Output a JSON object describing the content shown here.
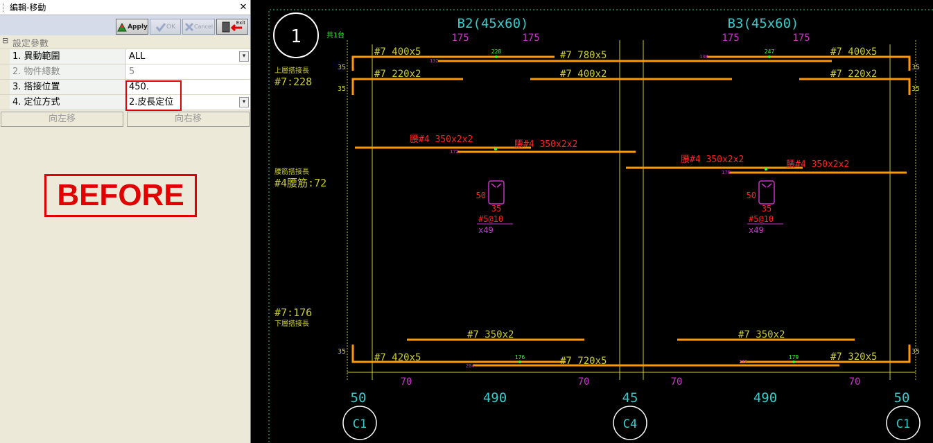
{
  "panel": {
    "title": "編輯-移動",
    "close_glyph": "✕",
    "toolbar": {
      "apply": "Apply",
      "ok": "OK",
      "cancel": "Cancel",
      "exit": "Exit"
    },
    "category": "設定參數",
    "category_toggle": "⊟",
    "rows": [
      {
        "label": "1. 異動範圍",
        "value": "ALL",
        "dropdown": true
      },
      {
        "label": "2. 物件總數",
        "value": "5",
        "disabled": true
      },
      {
        "label": "3. 搭接位置",
        "value": "450."
      },
      {
        "label": "4. 定位方式",
        "value": "2.皮長定位",
        "dropdown": true
      }
    ],
    "move_left": "向左移",
    "move_right": "向右移",
    "stamp": "BEFORE"
  },
  "drawing": {
    "colors": {
      "background": "#000000",
      "cyan": "#33cccc",
      "yellow": "#cccc33",
      "orange": "#ff9900",
      "magenta": "#cc33cc",
      "red": "#ff2222",
      "green": "#33ff33",
      "white": "#ffffff"
    },
    "circle_label": "1",
    "count_label": "共1台",
    "beam_b2": "B2(45x60)",
    "beam_b3": "B3(45x60)",
    "dim_175": "175",
    "top_lap_label": "上層搭接長",
    "top_lap_value": "#7:228",
    "waist_lap_label": "腰筋搭接長",
    "waist_lap_value": "#4腰筋:72",
    "bottom_lap_value": "#7:176",
    "bottom_lap_label": "下層搭接長",
    "top_bars": {
      "b2_t1": "#7 400x5",
      "b2_t1_right": "#7 780x5",
      "b3_t1": "#7 400x5",
      "b2_t2": "#7 220x2",
      "b2_t2_right": "#7 400x2",
      "b3_t2": "#7 220x2"
    },
    "waist_bars": {
      "b2_a": "腰#4 350x2x2",
      "b2_b": "腰#4 350x2x2",
      "b3_a": "腰#4 350x2x2",
      "b3_b": "腰#4 350x2x2"
    },
    "bottom_bars": {
      "b2_b2": "#7 350x2",
      "b3_b2": "#7 350x2",
      "b2_b1": "#7 420x5",
      "b2_b1_right": "#7 720x5",
      "b3_b1": "#7 320x5"
    },
    "lap_marks": {
      "t_228": "228",
      "t_132": "132",
      "t_130": "130",
      "t_247": "247",
      "w_172": "172",
      "w_176": "176",
      "b_176": "176",
      "b_204": "204",
      "b_210": "210",
      "b_179": "179"
    },
    "stirrup": {
      "height": "50",
      "width": "35",
      "spec": "#5@10",
      "count": "x49"
    },
    "end_35": "35",
    "dim_70": "70",
    "span_50": "50",
    "span_490": "490",
    "span_45": "45",
    "columns": {
      "left": "C1",
      "middle": "C4",
      "right": "C1"
    }
  }
}
